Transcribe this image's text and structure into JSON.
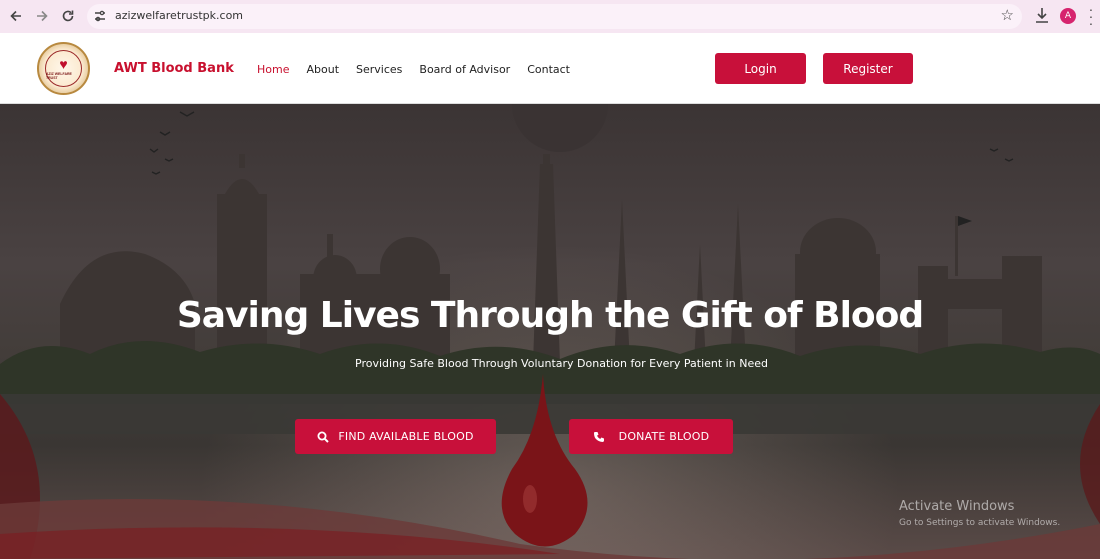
{
  "browser": {
    "url": "azizwelfaretrustpk.com",
    "profile_initial": "A",
    "icons": [
      "back-arrow-icon",
      "forward-arrow-icon",
      "reload-icon",
      "site-settings-icon",
      "bookmark-star-icon",
      "download-icon",
      "more-menu-icon"
    ]
  },
  "header": {
    "logo_text": "AZIZ WELFARE TRUST",
    "brand": "AWT Blood Bank",
    "nav": [
      {
        "label": "Home",
        "active": true
      },
      {
        "label": "About",
        "active": false
      },
      {
        "label": "Services",
        "active": false
      },
      {
        "label": "Board of Advisor",
        "active": false
      },
      {
        "label": "Contact",
        "active": false
      }
    ],
    "login_label": "Login",
    "register_label": "Register"
  },
  "hero": {
    "title": "Saving Lives Through the Gift of Blood",
    "subtitle": "Providing Safe Blood Through Voluntary Donation for Every Patient in Need",
    "find_label": "FIND AVAILABLE BLOOD",
    "donate_label": "DONATE BLOOD"
  },
  "watermark": {
    "title": "Activate Windows",
    "subtitle": "Go to Settings to activate Windows."
  },
  "colors": {
    "accent": "#c8103a",
    "brand": "#c8102e",
    "chrome": "#f6e6f2"
  }
}
